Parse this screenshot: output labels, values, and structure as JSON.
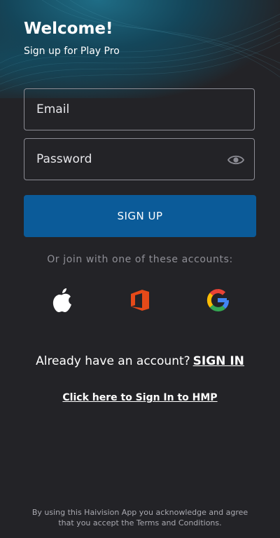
{
  "header": {
    "title": "Welcome!",
    "subtitle": "Sign up for Play Pro"
  },
  "form": {
    "email": {
      "placeholder": "Email",
      "value": ""
    },
    "password": {
      "placeholder": "Password",
      "value": "",
      "toggle_icon": "eye-icon"
    },
    "signup_label": "SIGN UP"
  },
  "social": {
    "prompt": "Or join with one of these accounts:",
    "providers": [
      {
        "name": "Apple",
        "icon": "apple-icon",
        "color": "#ffffff"
      },
      {
        "name": "Office",
        "icon": "office-icon",
        "color": "#e64a19"
      },
      {
        "name": "Google",
        "icon": "google-icon",
        "color": "#4285f4"
      }
    ]
  },
  "signin": {
    "prompt": "Already have an account?",
    "link": "SIGN IN"
  },
  "hmp_link": "Click here to Sign In to HMP",
  "legal": "By using this Haivision App you acknowledge and agree that you accept the Terms and Conditions.",
  "colors": {
    "background": "#232327",
    "primary_button": "#0b5b99",
    "hero_teal": "#1f6d86"
  }
}
